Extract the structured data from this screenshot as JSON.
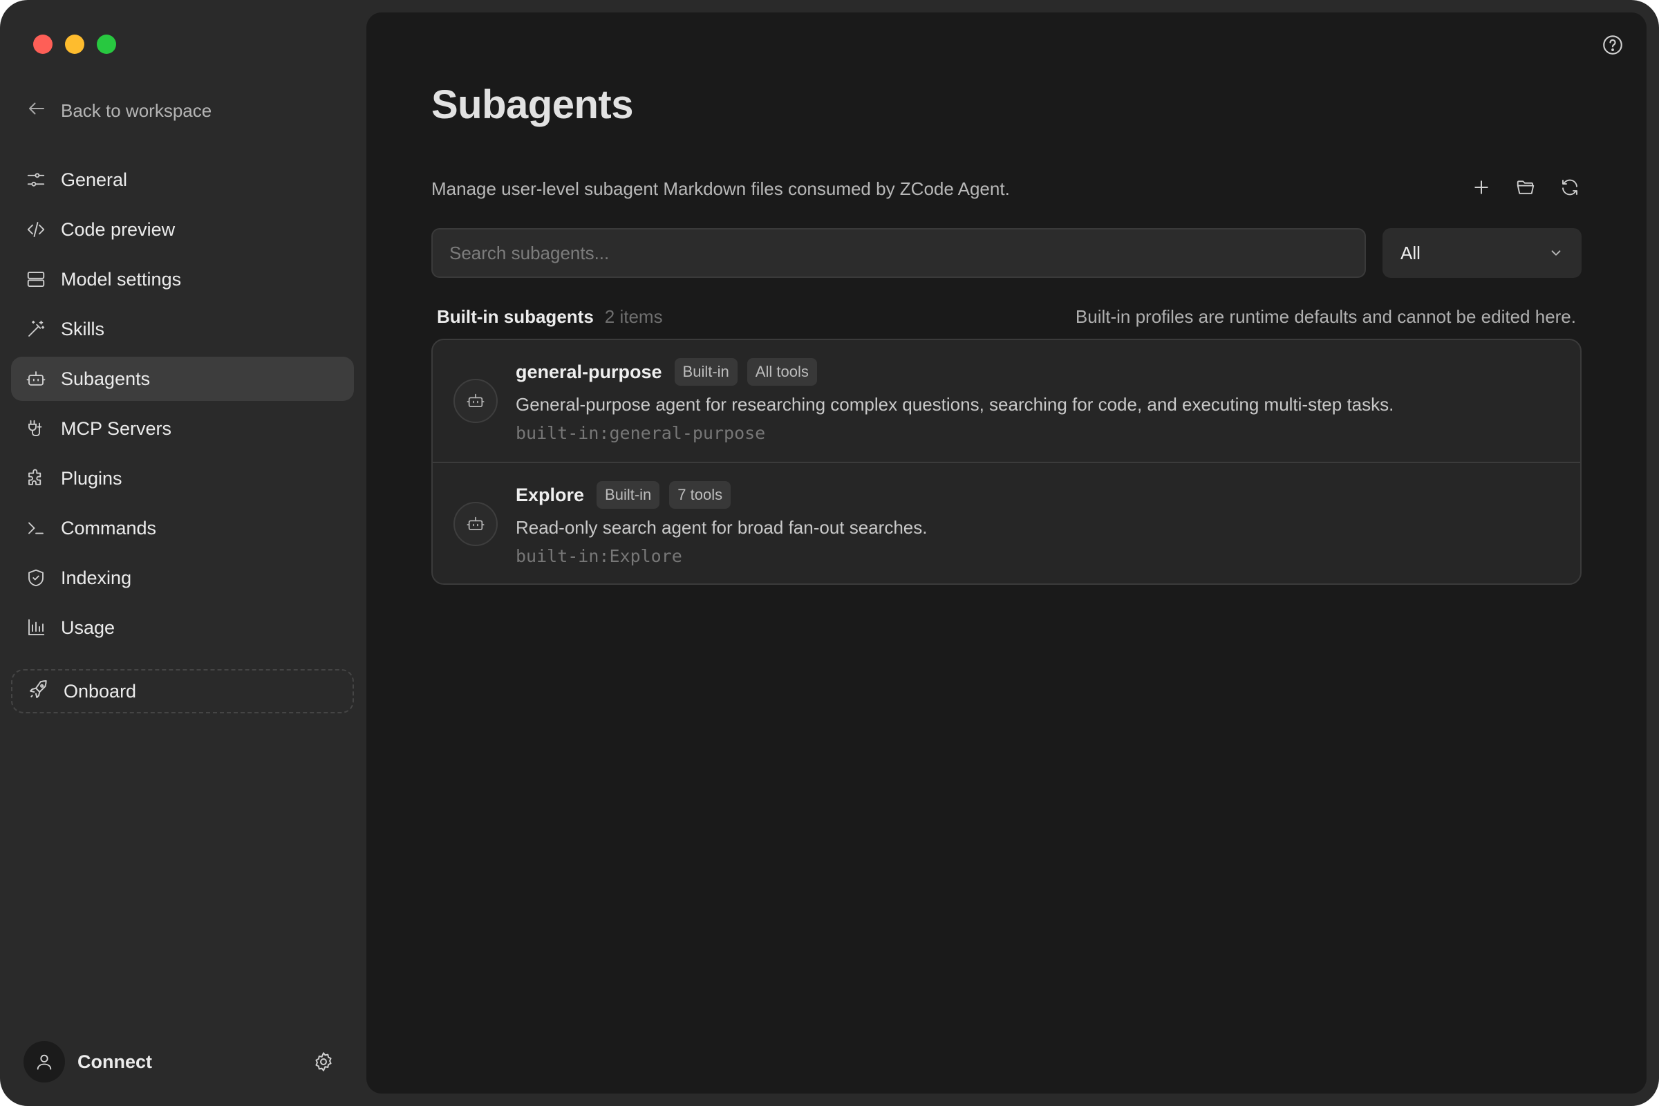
{
  "sidebar": {
    "back_label": "Back to workspace",
    "items": [
      {
        "label": "General",
        "icon": "sliders-icon"
      },
      {
        "label": "Code preview",
        "icon": "code-icon"
      },
      {
        "label": "Model settings",
        "icon": "server-icon"
      },
      {
        "label": "Skills",
        "icon": "wand-icon"
      },
      {
        "label": "Subagents",
        "icon": "bot-icon",
        "active": true
      },
      {
        "label": "MCP Servers",
        "icon": "plug-icon"
      },
      {
        "label": "Plugins",
        "icon": "puzzle-icon"
      },
      {
        "label": "Commands",
        "icon": "terminal-icon"
      },
      {
        "label": "Indexing",
        "icon": "shield-icon"
      },
      {
        "label": "Usage",
        "icon": "bar-chart-icon"
      }
    ],
    "onboard_label": "Onboard",
    "account_label": "Connect"
  },
  "main": {
    "title": "Subagents",
    "subtitle": "Manage user-level subagent Markdown files consumed by ZCode Agent.",
    "search_placeholder": "Search subagents...",
    "filter_value": "All",
    "section": {
      "title": "Built-in subagents",
      "count": "2 items",
      "note": "Built-in profiles are runtime defaults and cannot be edited here."
    },
    "agents": [
      {
        "name": "general-purpose",
        "badges": [
          "Built-in",
          "All tools"
        ],
        "description": "General-purpose agent for researching complex questions, searching for code, and executing multi-step tasks.",
        "id": "built-in:general-purpose"
      },
      {
        "name": "Explore",
        "badges": [
          "Built-in",
          "7 tools"
        ],
        "description": "Read-only search agent for broad fan-out searches.",
        "id": "built-in:Explore"
      }
    ]
  },
  "colors": {
    "window_bg": "#2a2a2a",
    "main_bg": "#1a1a1a",
    "active_item_bg": "#3d3d3d",
    "traffic_red": "#fe5f57",
    "traffic_yellow": "#febc2e",
    "traffic_green": "#28c840"
  }
}
